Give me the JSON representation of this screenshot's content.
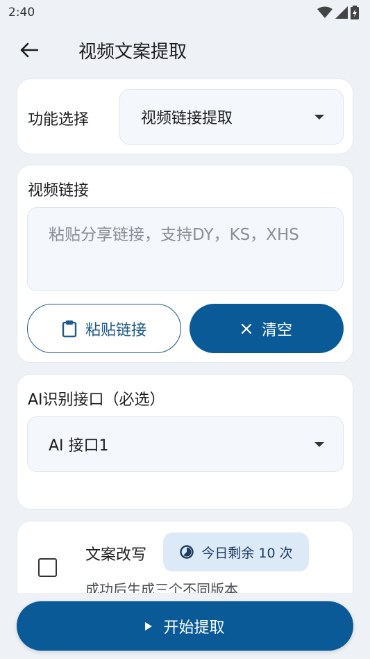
{
  "status_bar": {
    "time": "2:40",
    "icons": [
      "wifi-icon",
      "signal-icon",
      "battery-icon"
    ]
  },
  "app_bar": {
    "title": "视频文案提取",
    "back_icon": "arrow-back-icon"
  },
  "function_card": {
    "label": "功能选择",
    "selected": "视频链接提取"
  },
  "link_card": {
    "label": "视频链接",
    "placeholder": "粘贴分享链接，支持DY，KS，XHS",
    "paste_button": "粘贴链接",
    "clear_button": "清空"
  },
  "ai_card": {
    "label": "AI识别接口（必选）",
    "selected": "AI 接口1"
  },
  "rewrite_card": {
    "title": "文案改写",
    "quota": "今日剩余 10 次",
    "description": "成功后生成三个不同版本",
    "checked": false
  },
  "start_button": {
    "label": "开始提取"
  },
  "colors": {
    "primary": "#0b5a98",
    "outline": "#1e5b8c",
    "chip_bg": "#dce9f7",
    "page_bg": "#eef2f7"
  }
}
